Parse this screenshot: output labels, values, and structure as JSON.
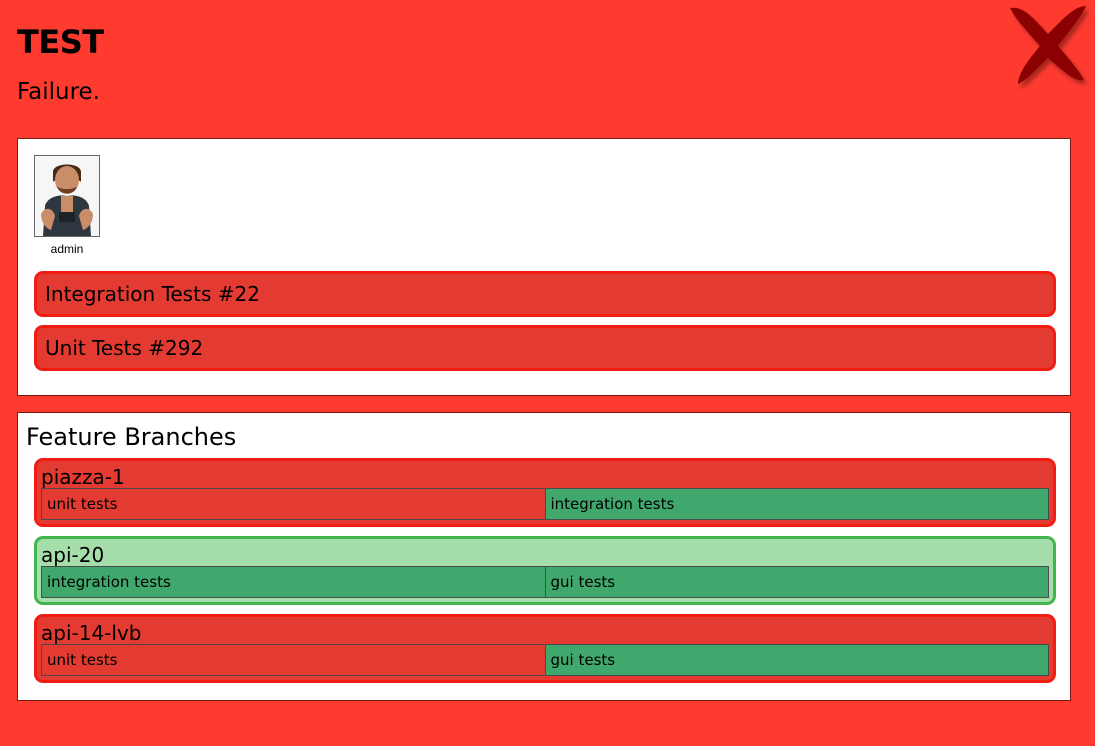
{
  "header": {
    "title": "TEST",
    "status_text": "Failure.",
    "status_icon": "x-mark-icon",
    "colors": {
      "background": "#ff3b30",
      "fail": "#e33b31",
      "fail_border": "#f21c12",
      "pass": "#40a86c",
      "branch_ok_background": "#a5deab",
      "branch_ok_border": "#42b54e",
      "x_mark": "#8b0000"
    }
  },
  "culprit": {
    "name": "admin"
  },
  "jobs": [
    {
      "label": "Integration Tests #22",
      "status": "failure"
    },
    {
      "label": "Unit Tests #292",
      "status": "failure"
    }
  ],
  "feature_branches": {
    "heading": "Feature Branches",
    "branches": [
      {
        "name": "piazza-1",
        "status": "failure",
        "jobs": [
          {
            "label": "unit tests",
            "status": "failure"
          },
          {
            "label": "integration tests",
            "status": "success"
          }
        ]
      },
      {
        "name": "api-20",
        "status": "success",
        "jobs": [
          {
            "label": "integration tests",
            "status": "success"
          },
          {
            "label": "gui tests",
            "status": "success"
          }
        ]
      },
      {
        "name": "api-14-lvb",
        "status": "failure",
        "jobs": [
          {
            "label": "unit tests",
            "status": "failure"
          },
          {
            "label": "gui tests",
            "status": "success"
          }
        ]
      }
    ]
  }
}
